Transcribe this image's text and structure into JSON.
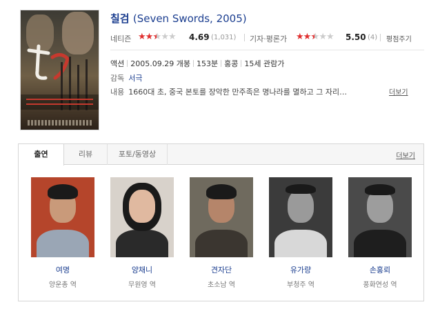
{
  "movie": {
    "title": "칠검",
    "original_title": "(Seven Swords, 2005)"
  },
  "ratings": {
    "netizen": {
      "label": "네티즌",
      "stars_filled": 2,
      "stars_half": 1,
      "stars_total": 5,
      "score": "4.69",
      "count": "(1,031)"
    },
    "critic": {
      "label": "기자·평론가",
      "stars_filled": 2,
      "stars_half": 1,
      "stars_total": 5,
      "score": "5.50",
      "count": "(4)"
    },
    "rate_link": "평점주기"
  },
  "info": {
    "genre": "액션",
    "release": "2005.09.29 개봉",
    "runtime": "153분",
    "country": "홍콩",
    "rating": "15세 관람가",
    "director_label": "감독",
    "director": "서극",
    "synopsis_label": "내용",
    "synopsis": "1660대 초, 중국 본토를 장악한 만주족은 명나라를 멸하고 그 자리…",
    "more_label": "더보기"
  },
  "cast_section": {
    "tabs": [
      {
        "label": "출연",
        "active": true
      },
      {
        "label": "리뷰",
        "active": false
      },
      {
        "label": "포토/동영상",
        "active": false
      }
    ],
    "more_label": "더보기",
    "actors": [
      {
        "name": "여명",
        "role": "양운총 역",
        "bg": "#b5452b",
        "skin": "#c99a7a",
        "shirt": "#9aa6b5"
      },
      {
        "name": "양채니",
        "role": "무원영 역",
        "bg": "#d8d2cb",
        "skin": "#e0b9a0",
        "shirt": "#2a2a2a"
      },
      {
        "name": "견자단",
        "role": "초소남 역",
        "bg": "#6f6a5e",
        "skin": "#b5856a",
        "shirt": "#3b3630"
      },
      {
        "name": "유가량",
        "role": "부청주 역",
        "bg": "#3b3b3b",
        "skin": "#9a9a9a",
        "shirt": "#d8d8d8"
      },
      {
        "name": "손홍뢰",
        "role": "풍화연성 역",
        "bg": "#4a4a4a",
        "skin": "#9d9d9d",
        "shirt": "#1e1e1e"
      }
    ]
  },
  "colors": {
    "link_blue": "#1a3d8f",
    "star_red": "#e02f2f",
    "star_grey": "#cccccc"
  }
}
